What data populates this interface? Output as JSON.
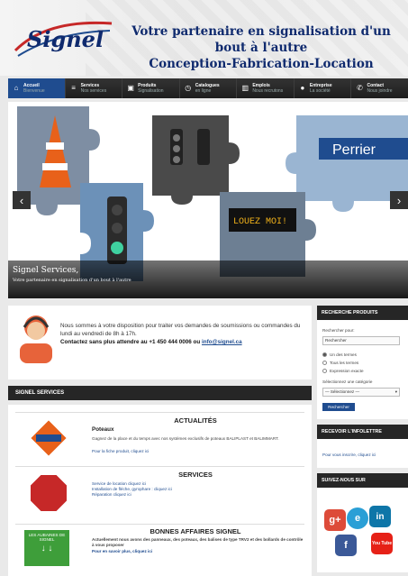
{
  "header": {
    "logo_text": "Signel",
    "tagline_line1": "Votre partenaire en signalisation d'un bout à l'autre",
    "tagline_line2": "Conception-Fabrication-Location"
  },
  "nav": {
    "items": [
      {
        "title": "Accueil",
        "subtitle": "Bienvenue",
        "icon": "home-icon"
      },
      {
        "title": "Services",
        "subtitle": "Nos services",
        "icon": "list-icon"
      },
      {
        "title": "Produits",
        "subtitle": "Signalisation",
        "icon": "box-icon"
      },
      {
        "title": "Catalogues",
        "subtitle": "en ligne",
        "icon": "clock-icon"
      },
      {
        "title": "Emplois",
        "subtitle": "Nous recrutons",
        "icon": "chart-icon"
      },
      {
        "title": "Entreprise",
        "subtitle": "La société",
        "icon": "circle-icon"
      },
      {
        "title": "Contact",
        "subtitle": "Nous joindre",
        "icon": "phone-icon"
      }
    ]
  },
  "slider": {
    "caption_title": "Signel Services,",
    "caption_sub": "Votre partenaire en signalisation d'un bout à l'autre",
    "sign_text": "LOUEZ MOI!",
    "street_sign": "Perrier",
    "prev_label": "‹",
    "next_label": "›"
  },
  "contact": {
    "text": "Nous sommes à votre disposition pour traiter vos demandes de soumissions ou commandes du lundi au vendredi de 8h à 17h.",
    "cta": "Contactez sans plus attendre au +1 450 444 0006 ou",
    "email": "info@signel.ca"
  },
  "services": {
    "bar_title": "SIGNEL SERVICES",
    "rows": [
      {
        "head": "ACTUALITÉS",
        "sub": "Poteaux",
        "desc": "Gagnez de la place et du temps avec nos systèmes exclusifs de poteaux BALIPLAST et BALIMMART.",
        "link": "Pour la fiche produit, cliquez ici",
        "badge": "Les actualités"
      },
      {
        "head": "SERVICES",
        "sub": "",
        "desc": "Service de location cliquez ici\nInstallation de fléche, gyrophare : cliquez ici\nRéparation cliquez ici",
        "link": "",
        "badge": "SERVICES"
      },
      {
        "head": "BONNES AFFAIRES SIGNEL",
        "sub": "",
        "desc": "Actuellement nous avons des panneaux, des poteaux, des balises de type TRV2 et des bollards de contrôle à vous proposer",
        "link": "Pour en savoir plus, cliquez ici",
        "badge": "LES AUBAINES DE SIGNEL"
      }
    ]
  },
  "sidebar": {
    "search_title": "RECHERCHE PRODUITS",
    "search_label": "Rechercher pour:",
    "search_value": "Rechercher",
    "radios": [
      "Un des termes",
      "Tous les termes",
      "Expression exacte"
    ],
    "category_label": "Sélectionnez une catégorie",
    "category_value": "— Sélectionnez —",
    "search_button": "Rechercher",
    "newsletter_title": "RECEVOIR L'INFOLETTRE",
    "newsletter_text": "Pour vous inscrire, cliquez ici",
    "social_title": "SUIVEZ-NOUS SUR",
    "social": [
      "g+",
      "e",
      "in",
      "f",
      "You Tube"
    ],
    "colors": {
      "accent": "#1f4c8f",
      "bar": "#262626"
    }
  }
}
